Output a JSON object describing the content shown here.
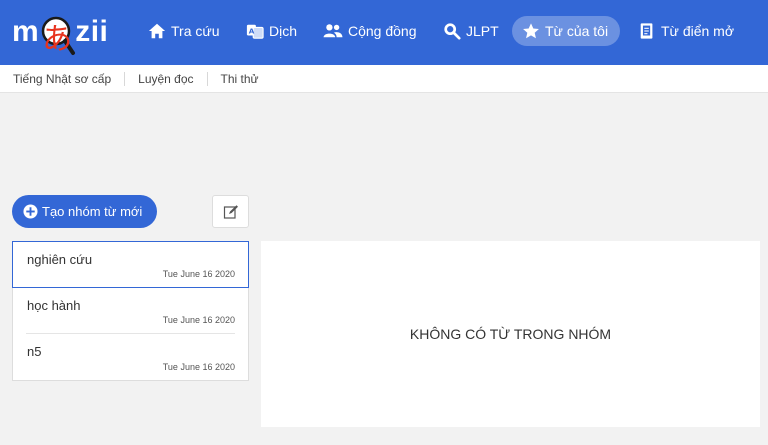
{
  "brand": {
    "logo_left": "m",
    "logo_kana": "あ",
    "logo_right": "zii"
  },
  "nav": [
    {
      "label": "Tra cứu",
      "icon": "home-icon"
    },
    {
      "label": "Dịch",
      "icon": "translate-icon"
    },
    {
      "label": "Cộng đồng",
      "icon": "users-icon"
    },
    {
      "label": "JLPT",
      "icon": "search-badge-icon"
    },
    {
      "label": "Từ của tôi",
      "icon": "star-icon",
      "active": true
    },
    {
      "label": "Từ điển mở",
      "icon": "open-dictionary-icon"
    }
  ],
  "subnav": [
    "Tiếng Nhật sơ cấp",
    "Luyện đọc",
    "Thi thử"
  ],
  "actions": {
    "create_label": "Tạo nhóm từ mới"
  },
  "groups": [
    {
      "name": "nghiên cứu",
      "date": "Tue June 16 2020",
      "selected": true
    },
    {
      "name": "học hành",
      "date": "Tue June 16 2020"
    },
    {
      "name": "n5",
      "date": "Tue June 16 2020"
    }
  ],
  "panel": {
    "empty_message": "KHÔNG CÓ TỪ TRONG NHÓM"
  },
  "colors": {
    "primary": "#3367d6",
    "kana": "#e8331e",
    "background": "#f2f2f2"
  }
}
